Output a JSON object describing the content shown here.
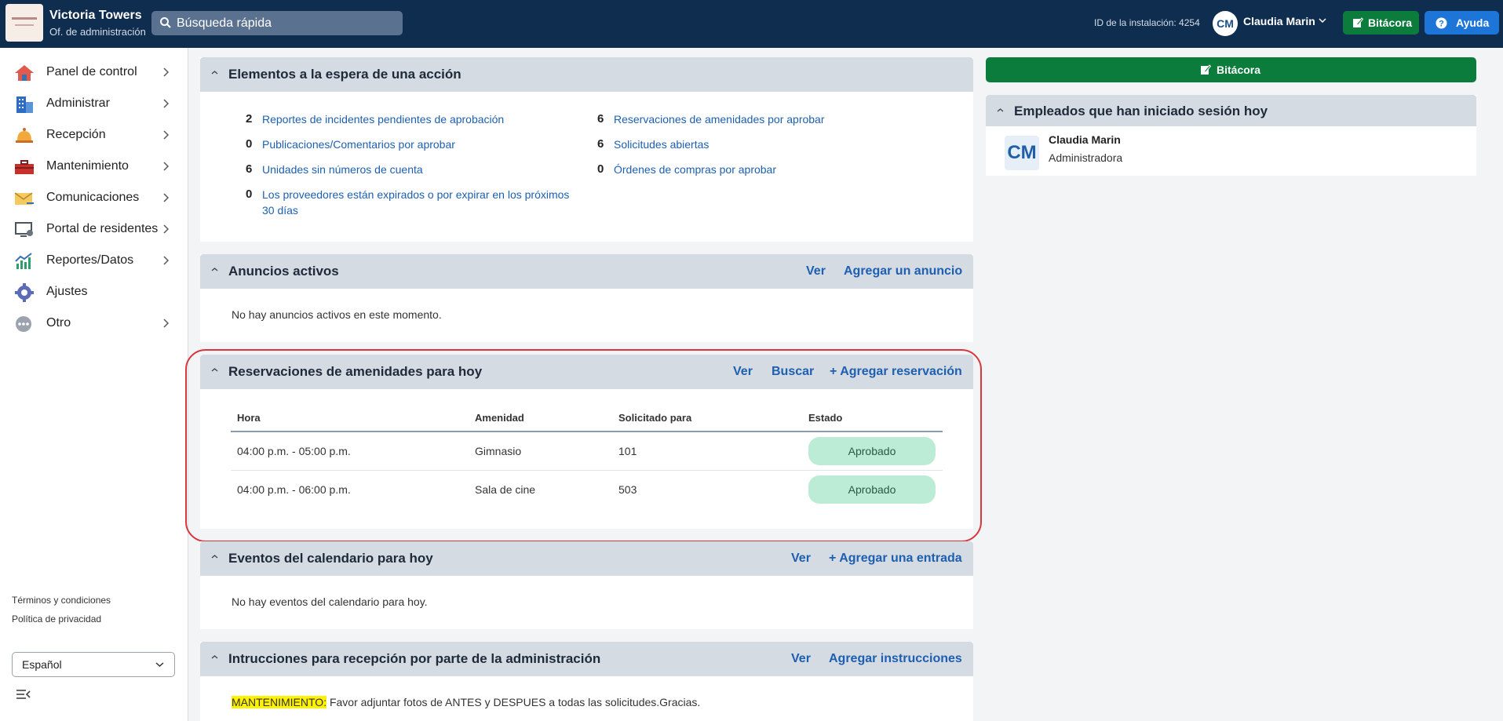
{
  "app": {
    "title": "Victoria Towers",
    "subtitle": "Of. de administración"
  },
  "search": {
    "placeholder": "Búsqueda rápida"
  },
  "topbar": {
    "installation": "ID de la instalación: 4254",
    "user_initials": "CM",
    "user_name": "Claudia Marin",
    "bitacora_label": "Bitácora",
    "ayuda_label": "Ayuda"
  },
  "sidebar": {
    "items": [
      {
        "label": "Panel de control",
        "icon": "house-icon"
      },
      {
        "label": "Administrar",
        "icon": "building-icon"
      },
      {
        "label": "Recepción",
        "icon": "bell-icon"
      },
      {
        "label": "Mantenimiento",
        "icon": "toolbox-icon"
      },
      {
        "label": "Comunicaciones",
        "icon": "mail-icon"
      },
      {
        "label": "Portal de residentes",
        "icon": "monitor-icon"
      },
      {
        "label": "Reportes/Datos",
        "icon": "chart-icon"
      },
      {
        "label": "Ajustes",
        "icon": "gear-icon"
      },
      {
        "label": "Otro",
        "icon": "more-icon"
      }
    ],
    "terms": "Términos y condiciones",
    "privacy": "Política de privacidad",
    "language": "Español"
  },
  "pending": {
    "title": "Elementos a la espera de una acción",
    "left": [
      {
        "count": "2",
        "label": "Reportes de incidentes pendientes de aprobación"
      },
      {
        "count": "0",
        "label": "Publicaciones/Comentarios por aprobar"
      },
      {
        "count": "6",
        "label": "Unidades sin números de cuenta"
      },
      {
        "count": "0",
        "label_line1": "Los proveedores están expirados o por expirar en los próximos",
        "label_line2": "30 días"
      }
    ],
    "right": [
      {
        "count": "6",
        "label": "Reservaciones de amenidades por aprobar"
      },
      {
        "count": "6",
        "label": "Solicitudes abiertas"
      },
      {
        "count": "0",
        "label": "Órdenes de compras por aprobar"
      }
    ]
  },
  "announcements": {
    "title": "Anuncios activos",
    "view": "Ver",
    "add": "Agregar un anuncio",
    "empty": "No hay anuncios activos en este momento."
  },
  "reservations": {
    "title": "Reservaciones de amenidades para hoy",
    "view": "Ver",
    "search": "Buscar",
    "add": "+ Agregar reservación",
    "columns": [
      "Hora",
      "Amenidad",
      "Solicitado para",
      "Estado"
    ],
    "rows": [
      {
        "time": "04:00 p.m. - 05:00 p.m.",
        "amenity": "Gimnasio",
        "unit": "101",
        "status": "Aprobado"
      },
      {
        "time": "04:00 p.m. - 06:00 p.m.",
        "amenity": "Sala de cine",
        "unit": "503",
        "status": "Aprobado"
      }
    ]
  },
  "calendar": {
    "title": "Eventos del calendario para hoy",
    "view": "Ver",
    "add": "+ Agregar una entrada",
    "empty": "No hay eventos del calendario para hoy."
  },
  "instructions": {
    "title": "Intrucciones para recepción por parte de la administración",
    "view": "Ver",
    "add": "Agregar instrucciones",
    "tag": "MANTENIMIENTO:",
    "text": " Favor adjuntar fotos de ANTES y DESPUES a todas las solicitudes.Gracias."
  },
  "side": {
    "bitacora_label": "Bitácora",
    "employees_title": "Empleados que han iniciado sesión hoy",
    "employee": {
      "initials": "CM",
      "name": "Claudia Marin",
      "role": "Administradora"
    }
  },
  "colors": {
    "topbar": "#0f2d4f",
    "green": "#0c7c3d",
    "blue": "#1d75d8",
    "link": "#1d5fb0",
    "badge": "#bdecd6",
    "highlight": "#d9363e"
  }
}
